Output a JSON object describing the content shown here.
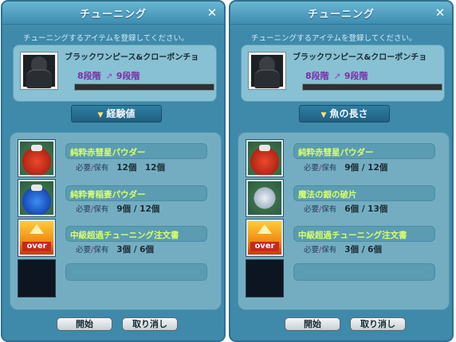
{
  "windows": [
    {
      "title": "チューニング",
      "instruction": "チューニングするアイテムを登録してください。",
      "item": {
        "name": "ブラックワンピース&クローポンチョ",
        "level_current": "8段階",
        "level_next": "9段階"
      },
      "type_button": "経験値",
      "materials": [
        {
          "name": "純粋赤彗星パウダー",
          "req_label_a": "必要",
          "req_label_b": "保有",
          "value": "12個　12個",
          "icon": "red-powder-icon"
        },
        {
          "name": "純粋青稲妻パウダー",
          "req_label_a": "必要",
          "req_label_b": "保有",
          "value": "9個 / 12個",
          "icon": "blue-powder-icon"
        },
        {
          "name": "中級超過チューニング注文書",
          "req_label_a": "必要",
          "req_label_b": "保有",
          "value": "3個 / 6個",
          "icon": "over-scroll-icon",
          "badge": "over"
        }
      ],
      "buttons": {
        "start": "開始",
        "cancel": "取り消し"
      }
    },
    {
      "title": "チューニング",
      "instruction": "チューニングするアイテムを登録してください。",
      "item": {
        "name": "ブラックワンピース&クローポンチョ",
        "level_current": "8段階",
        "level_next": "9段階"
      },
      "type_button": "魚の長さ",
      "materials": [
        {
          "name": "純粋赤彗星パウダー",
          "req_label_a": "必要",
          "req_label_b": "保有",
          "value": "9個 / 12個",
          "icon": "red-powder-icon"
        },
        {
          "name": "魔法の銀の破片",
          "req_label_a": "必要",
          "req_label_b": "保有",
          "value": "6個 / 13個",
          "icon": "silver-shard-icon"
        },
        {
          "name": "中級超過チューニング注文書",
          "req_label_a": "必要",
          "req_label_b": "保有",
          "value": "3個 / 6個",
          "icon": "over-scroll-icon",
          "badge": "over"
        }
      ],
      "buttons": {
        "start": "開始",
        "cancel": "取り消し"
      }
    }
  ],
  "colors": {
    "window_bg": "#3f89aa",
    "material_name": "#d7ff6a",
    "level_text": "#7a2fa8"
  }
}
